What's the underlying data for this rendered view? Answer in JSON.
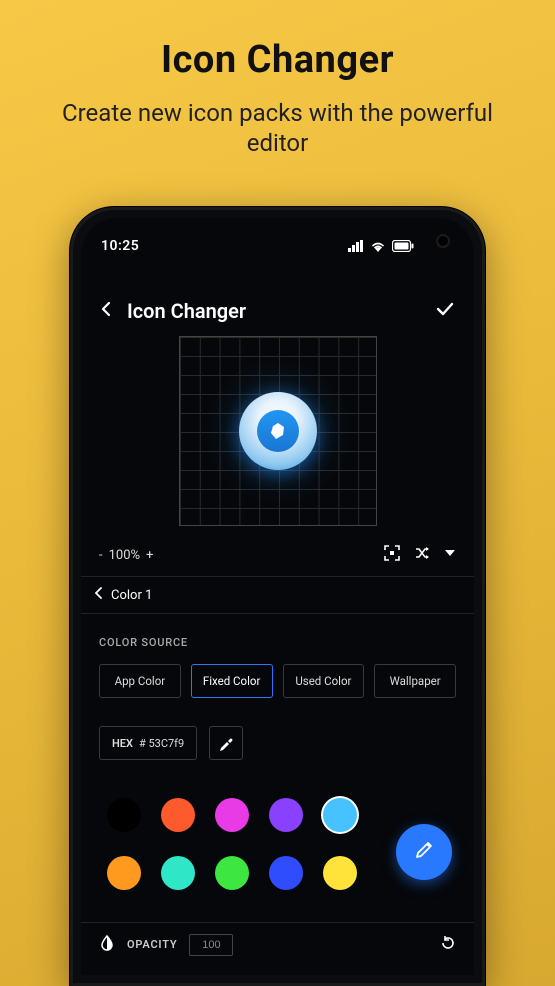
{
  "promo": {
    "title": "Icon Changer",
    "subtitle": "Create new icon packs with the powerful editor"
  },
  "status": {
    "time": "10:25"
  },
  "appbar": {
    "title": "Icon Changer"
  },
  "zoom": {
    "minus": "-",
    "value": "100%",
    "plus": "+"
  },
  "subheader": {
    "title": "Color 1"
  },
  "colorSource": {
    "label": "COLOR SOURCE",
    "options": [
      "App Color",
      "Fixed Color",
      "Used Color",
      "Wallpaper"
    ],
    "selected": 1
  },
  "hex": {
    "label": "HEX",
    "value": "# 53C7f9"
  },
  "swatches": {
    "row1": [
      "#000000",
      "#ff5a2d",
      "#e83be5",
      "#8a40ff",
      "#45c2ff"
    ],
    "row2": [
      "#ff9a1f",
      "#2fe7c7",
      "#3ee642",
      "#2f4dff",
      "#ffe23a"
    ],
    "selectedRow1Index": 4
  },
  "opacity": {
    "label": "OPACITY",
    "value": "100"
  },
  "icons": {
    "back": "chevron-left-icon",
    "confirm": "check-icon",
    "frame": "frame-icon",
    "shuffle": "shuffle-icon",
    "dropdown": "dropdown-icon",
    "subback": "chevron-left-icon",
    "eyedropper": "eyedropper-icon",
    "fab": "pencil-icon",
    "opacity": "opacity-icon",
    "reset": "reset-icon"
  },
  "accent": "#2979ff"
}
